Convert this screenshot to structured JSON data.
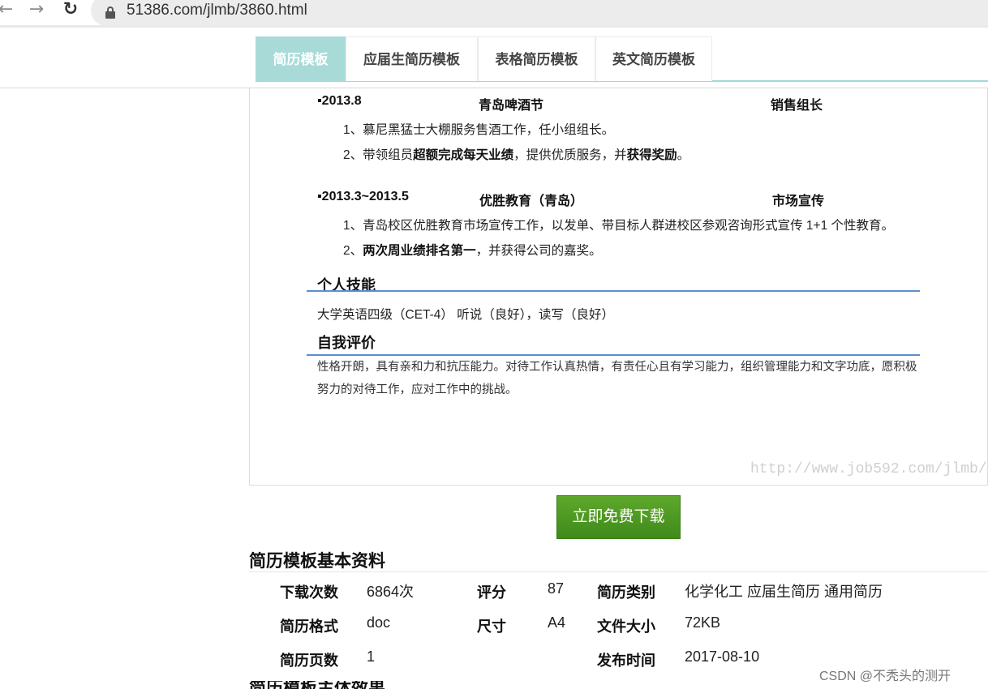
{
  "browser": {
    "url": "51386.com/jlmb/3860.html",
    "back_icon": "←",
    "forward_icon": "→",
    "reload_icon": "↻"
  },
  "tabs": [
    {
      "label": "简历模板",
      "active": true
    },
    {
      "label": "应届生简历模板",
      "active": false
    },
    {
      "label": "表格简历模板",
      "active": false
    },
    {
      "label": "英文简历模板",
      "active": false
    }
  ],
  "preview": {
    "jobs": [
      {
        "date": "▪2013.8",
        "company": "青岛啤酒节",
        "role": "销售组长",
        "line1": "1、慕尼黑猛士大棚服务售酒工作，任小组组长。",
        "line2_pre": "2、带领组员",
        "line2_bold1": "超额完成每天业绩",
        "line2_mid": "，提供优质服务，并",
        "line2_bold2": "获得奖励",
        "line2_end": "。"
      },
      {
        "date": "▪2013.3~2013.5",
        "company": "优胜教育（青岛）",
        "role": "市场宣传",
        "line1": "1、青岛校区优胜教育市场宣传工作，以发单、带目标人群进校区参观咨询形式宣传 1+1 个性教育。",
        "line2_pre": "2、",
        "line2_bold1": "两次周业绩排名第一",
        "line2_mid": "，并获得公司的嘉奖。"
      }
    ],
    "skills_title": "个人技能",
    "skills_text": "大学英语四级（CET-4）    听说（良好），读写（良好）",
    "eval_title": "自我评价",
    "eval_text": "性格开朗，具有亲和力和抗压能力。对待工作认真热情，有责任心且有学习能力，组织管理能力和文字功底，愿积极努力的对待工作，应对工作中的挑战。",
    "watermark": "http://www.job592.com/jlmb/"
  },
  "download_label": "立即免费下载",
  "info": {
    "title": "简历模板基本资料",
    "downloads_label": "下载次数",
    "downloads_value": "6864次",
    "rating_label": "评分",
    "rating_value": "87",
    "category_label": "简历类别",
    "category_value": "化学化工 应届生简历 通用简历",
    "format_label": "简历格式",
    "format_value": "doc",
    "size_label": "尺寸",
    "size_value": "A4",
    "filesize_label": "文件大小",
    "filesize_value": "72KB",
    "pages_label": "简历页数",
    "pages_value": "1",
    "date_label": "发布时间",
    "date_value": "2017-08-10"
  },
  "next_section_fragment": "简历模板主体效果",
  "csdn_mark": "CSDN @不秃头的测开"
}
